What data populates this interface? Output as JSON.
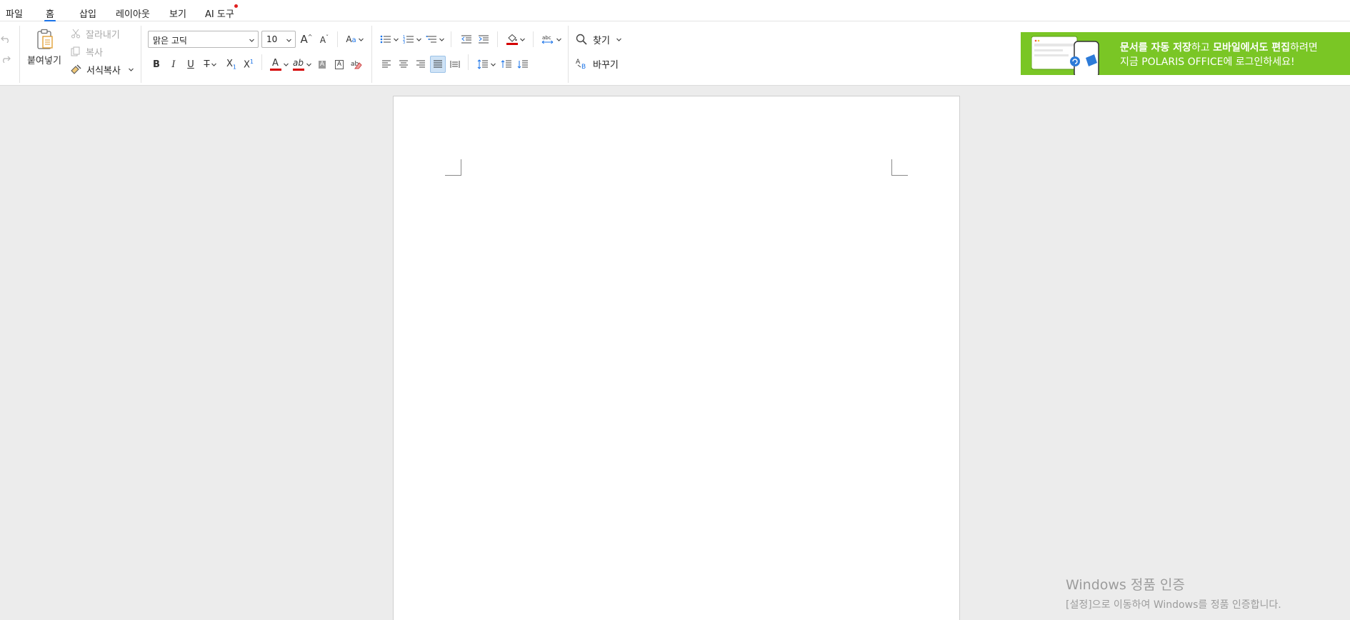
{
  "menu": {
    "items": [
      "파일",
      "홈",
      "삽입",
      "레이아웃",
      "보기",
      "AI 도구"
    ],
    "active": "홈"
  },
  "ribbon": {
    "clipboard": {
      "paste": "붙여넣기",
      "cut": "잘라내기",
      "copy": "복사",
      "format_painter": "서식복사"
    },
    "font": {
      "name": "맑은 고딕",
      "size": "10"
    },
    "find": "찾기",
    "replace": "바꾸기"
  },
  "banner": {
    "line1_bold1": "문서를 자동 저장",
    "line1_mid": "하고 ",
    "line1_bold2": "모바일에서도 편집",
    "line1_end": "하려면",
    "line2": "지금 POLARIS OFFICE에 로그인하세요!",
    "color": "#7ac625"
  },
  "watermark": {
    "title": "Windows 정품 인증",
    "subtitle": "[설정]으로 이동하여 Windows를 정품 인증합니다."
  },
  "colors": {
    "accent": "#1a73e8",
    "font_color_bar": "#d40000",
    "highlight_bar": "#d40000"
  }
}
